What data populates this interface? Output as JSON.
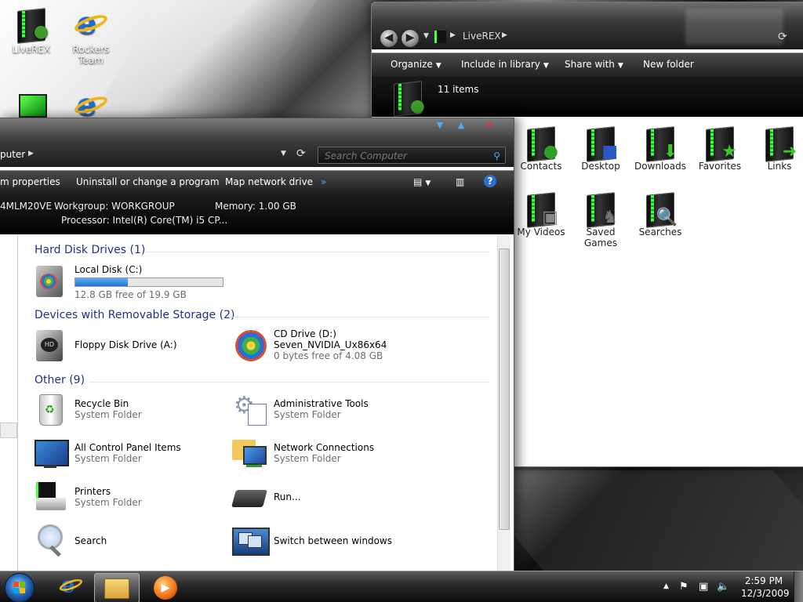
{
  "desktop": {
    "icons": [
      {
        "label": "LiveREX"
      },
      {
        "label": "Rockers Team"
      }
    ]
  },
  "library_window": {
    "address": "LiveREX",
    "commands": [
      "Organize",
      "Include in library",
      "Share with",
      "New folder"
    ],
    "item_count": "11 items",
    "items": [
      {
        "label": "Contacts"
      },
      {
        "label": "Desktop"
      },
      {
        "label": "Downloads"
      },
      {
        "label": "Favorites"
      },
      {
        "label": "Links"
      },
      {
        "label": "My Videos"
      },
      {
        "label": "Saved Games"
      },
      {
        "label": "Searches"
      }
    ]
  },
  "computer_window": {
    "address": "puter",
    "search_placeholder": "Search Computer",
    "commands": [
      "m properties",
      "Uninstall or change a program",
      "Map network drive",
      "»"
    ],
    "details": {
      "name": "4MLM20VE",
      "workgroup": "Workgroup: WORKGROUP",
      "memory": "Memory: 1.00 GB",
      "processor": "Processor: Intel(R) Core(TM) i5 CP..."
    },
    "groups": [
      {
        "title": "Hard Disk Drives (1)"
      },
      {
        "title": "Devices with Removable Storage (2)"
      },
      {
        "title": "Other (9)"
      }
    ],
    "local_disk": {
      "name": "Local Disk (C:)",
      "free": "12.8 GB free of 19.9 GB",
      "used_fraction": 0.357
    },
    "floppy": {
      "name": "Floppy Disk Drive (A:)"
    },
    "cd_drive": {
      "name": "CD Drive (D:)",
      "volume": "Seven_NVIDIA_Ux86x64",
      "free": "0 bytes free of 4.08 GB"
    },
    "other_items": [
      {
        "name": "Recycle Bin",
        "type": "System Folder"
      },
      {
        "name": "Administrative Tools",
        "type": "System Folder"
      },
      {
        "name": "All Control Panel Items",
        "type": "System Folder"
      },
      {
        "name": "Network Connections",
        "type": "System Folder"
      },
      {
        "name": "Printers",
        "type": "System Folder"
      },
      {
        "name": "Run...",
        "type": ""
      },
      {
        "name": "Search",
        "type": ""
      },
      {
        "name": "Switch between windows",
        "type": ""
      }
    ]
  },
  "taskbar": {
    "time": "2:59 PM",
    "date": "12/3/2009"
  },
  "colors": {
    "group_header": "#1e3287",
    "accent_green": "#4cff3c",
    "drive_fill": "#1d78d6"
  }
}
